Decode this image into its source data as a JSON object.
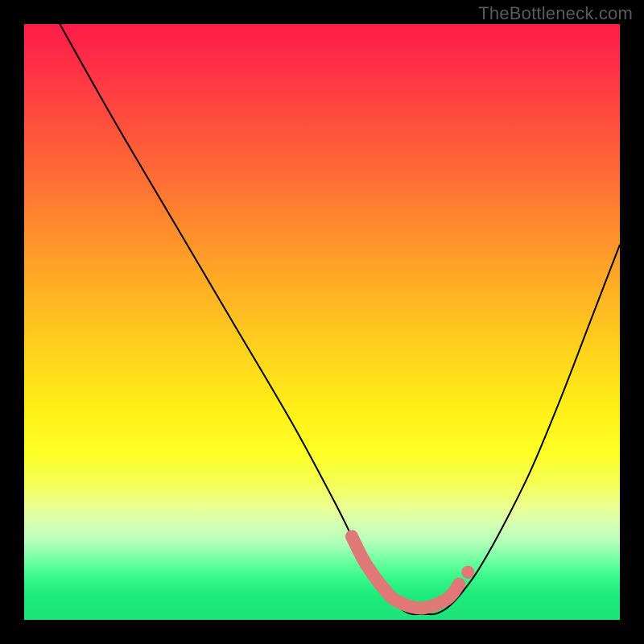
{
  "attribution": "TheBottleneck.com",
  "chart_data": {
    "type": "line",
    "title": "",
    "xlabel": "",
    "ylabel": "",
    "xlim": [
      0,
      100
    ],
    "ylim": [
      0,
      100
    ],
    "series": [
      {
        "name": "curve",
        "x": [
          6,
          15,
          25,
          35,
          45,
          52,
          55,
          58,
          61,
          63,
          65,
          67,
          69,
          71,
          73,
          76,
          80,
          85,
          90,
          95,
          100
        ],
        "y": [
          100,
          84,
          67,
          50,
          33,
          20,
          14,
          8,
          4,
          2,
          1,
          1,
          1,
          2,
          4,
          8,
          15,
          25,
          37,
          50,
          63
        ]
      }
    ],
    "markers": {
      "color": "#e07878",
      "points_x": [
        55,
        57,
        59,
        61,
        62,
        63,
        64,
        65,
        66,
        67,
        68,
        69,
        70,
        71,
        72,
        73
      ],
      "points_y": [
        14,
        10,
        7,
        4.5,
        3.5,
        3,
        2.5,
        2.2,
        2,
        2,
        2.2,
        2.5,
        3,
        3.5,
        4.5,
        6
      ]
    },
    "gradient_colors": {
      "top": "#ff1d4a",
      "mid": "#fff018",
      "bottom": "#1de27a"
    }
  }
}
